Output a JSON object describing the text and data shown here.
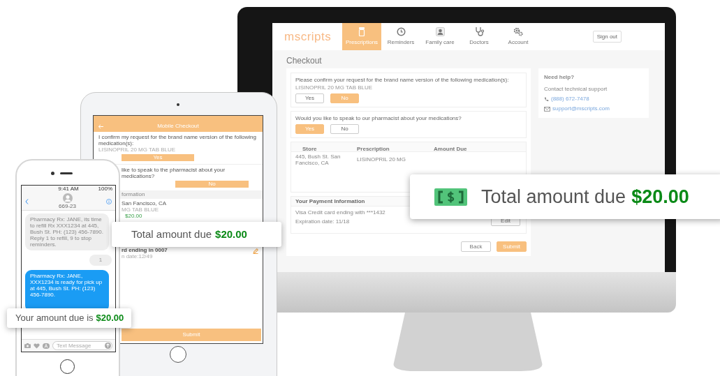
{
  "desktop": {
    "logo": "mscripts",
    "nav": [
      {
        "label": "Prescriptions",
        "selected": true
      },
      {
        "label": "Reminders",
        "selected": false
      },
      {
        "label": "Family care",
        "selected": false
      },
      {
        "label": "Doctors",
        "selected": false
      },
      {
        "label": "Account",
        "selected": false
      }
    ],
    "sign_out": "Sign out",
    "page_title": "Checkout",
    "brand_question": {
      "text": "Please confirm your request for the brand name version of the following medication(s):",
      "medication": "LISINOPRIL 20 MG TAB BLUE",
      "options": [
        {
          "label": "Yes",
          "selected": false
        },
        {
          "label": "No",
          "selected": true
        }
      ]
    },
    "pharmacist_question": {
      "text": "Would you like to speak to our pharmacist about your medications?",
      "options": [
        {
          "label": "Yes",
          "selected": true
        },
        {
          "label": "No",
          "selected": false
        }
      ]
    },
    "table": {
      "columns": [
        "Store",
        "Prescription",
        "Amount Due"
      ],
      "rows": [
        [
          "445, Bush St. San Fancisco, CA",
          "LISINOPRIL 20 MG"
        ]
      ]
    },
    "payment": {
      "title": "Your Payment Information",
      "card": "Visa Credit card ending with ***1432",
      "expiration": "Expiration date: 11/18",
      "edit": "Edit"
    },
    "buttons": [
      {
        "label": "Back",
        "kind": "secondary"
      },
      {
        "label": "Submit",
        "kind": "primary"
      }
    ],
    "help": {
      "title": "Need help?",
      "subtitle": "Contact technical support",
      "phone": "(888) 672-7478",
      "email": "support@mscripts.com"
    }
  },
  "desktop_callout": {
    "label": "Total amount due",
    "amount": "$20.00"
  },
  "tablet": {
    "title": "Mobile Checkout",
    "brand_question": {
      "text": "I confirm my request for the brand name version of the following medication(s):",
      "medication": "LISINOPRIL 20 MG TAB BLUE",
      "answer": "Yes"
    },
    "pharmacist_question": {
      "text": "like to speak to the pharmacist about your medications?",
      "answer": "No"
    },
    "section": "formation",
    "store": "San Fancisco, CA",
    "medication": "MG TAB BLUE",
    "amount": "$20.00",
    "card": "rd ending in 0007",
    "expiration": "n date:12/49",
    "submit": "Submit"
  },
  "tablet_callout": {
    "label": "Total amount due",
    "amount": "$20.00"
  },
  "phone": {
    "time": "9:41 AM",
    "battery": "100%",
    "contact": "669-23",
    "messages": [
      {
        "kind": "incoming",
        "text": "Pharmacy Rx: JANE, its time to refill Rx XXX1234 at 445, Bush St. PH: (123) 456-7890. Reply 1 to refill, 9 to stop reminders."
      },
      {
        "kind": "reply",
        "text": "1"
      },
      {
        "kind": "outgoing",
        "text": "Pharmacy Rx: JANE, XXX1234 is ready for pick up at 445, Bush St. PH: (123) 456-7890."
      }
    ],
    "placeholder": "Text Message"
  },
  "phone_callout": {
    "label": "Your amount due is",
    "amount": "$20.00"
  }
}
